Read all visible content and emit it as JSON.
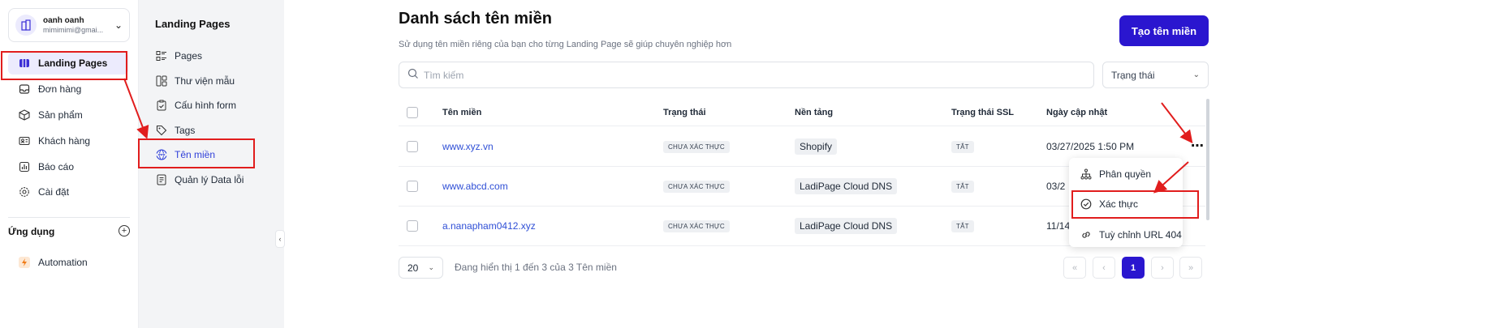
{
  "account": {
    "name": "oanh oanh",
    "email": "mimimimi@gmai..."
  },
  "sidebar": {
    "items": [
      {
        "label": "Landing Pages",
        "icon": "pages-icon",
        "active": true
      },
      {
        "label": "Đơn hàng",
        "icon": "inbox-icon"
      },
      {
        "label": "Sản phẩm",
        "icon": "box-icon"
      },
      {
        "label": "Khách hàng",
        "icon": "contact-card-icon"
      },
      {
        "label": "Báo cáo",
        "icon": "chart-icon"
      },
      {
        "label": "Cài đặt",
        "icon": "gear-icon"
      }
    ],
    "apps_title": "Ứng dụng",
    "apps": [
      {
        "label": "Automation",
        "icon": "lightning-icon"
      }
    ]
  },
  "subbar": {
    "title": "Landing Pages",
    "items": [
      {
        "label": "Pages",
        "icon": "list-icon"
      },
      {
        "label": "Thư viện mẫu",
        "icon": "layout-icon"
      },
      {
        "label": "Cấu hình form",
        "icon": "clipboard-icon"
      },
      {
        "label": "Tags",
        "icon": "tag-icon"
      },
      {
        "label": "Tên miền",
        "icon": "www-globe-icon",
        "active": true
      },
      {
        "label": "Quản lý Data lỗi",
        "icon": "document-icon"
      }
    ]
  },
  "main": {
    "title": "Danh sách tên miền",
    "subtitle": "Sử dụng tên miền riêng của bạn cho từng Landing Page sẽ giúp chuyên nghiệp hơn",
    "create_label": "Tạo tên miền",
    "search_placeholder": "Tìm kiếm",
    "status_filter": "Trạng thái",
    "columns": [
      "Tên miền",
      "Trạng thái",
      "Nền tảng",
      "Trạng thái SSL",
      "Ngày cập nhật"
    ],
    "rows": [
      {
        "domain": "www.xyz.vn",
        "status": "CHƯA XÁC THỰC",
        "platform": "Shopify",
        "ssl": "TẮT",
        "updated": "03/27/2025 1:50 PM"
      },
      {
        "domain": "www.abcd.com",
        "status": "CHƯA XÁC THỰC",
        "platform": "LadiPage Cloud DNS",
        "ssl": "TẮT",
        "updated": "03/2"
      },
      {
        "domain": "a.nanapham0412.xyz",
        "status": "CHƯA XÁC THỰC",
        "platform": "LadiPage Cloud DNS",
        "ssl": "TẮT",
        "updated": "11/14"
      }
    ],
    "menu": [
      {
        "label": "Phân quyền",
        "icon": "hierarchy-icon"
      },
      {
        "label": "Xác thực",
        "icon": "check-circle-icon"
      },
      {
        "label": "Tuỳ chỉnh URL 404",
        "icon": "link-icon"
      }
    ],
    "pagination": {
      "per_page": "20",
      "info": "Đang hiển thị 1 đến 3 của 3 Tên miền",
      "current_page": "1"
    }
  },
  "colors": {
    "accent": "#2a16cf",
    "annotation": "#e11d1d",
    "link": "#2f4fd6"
  }
}
